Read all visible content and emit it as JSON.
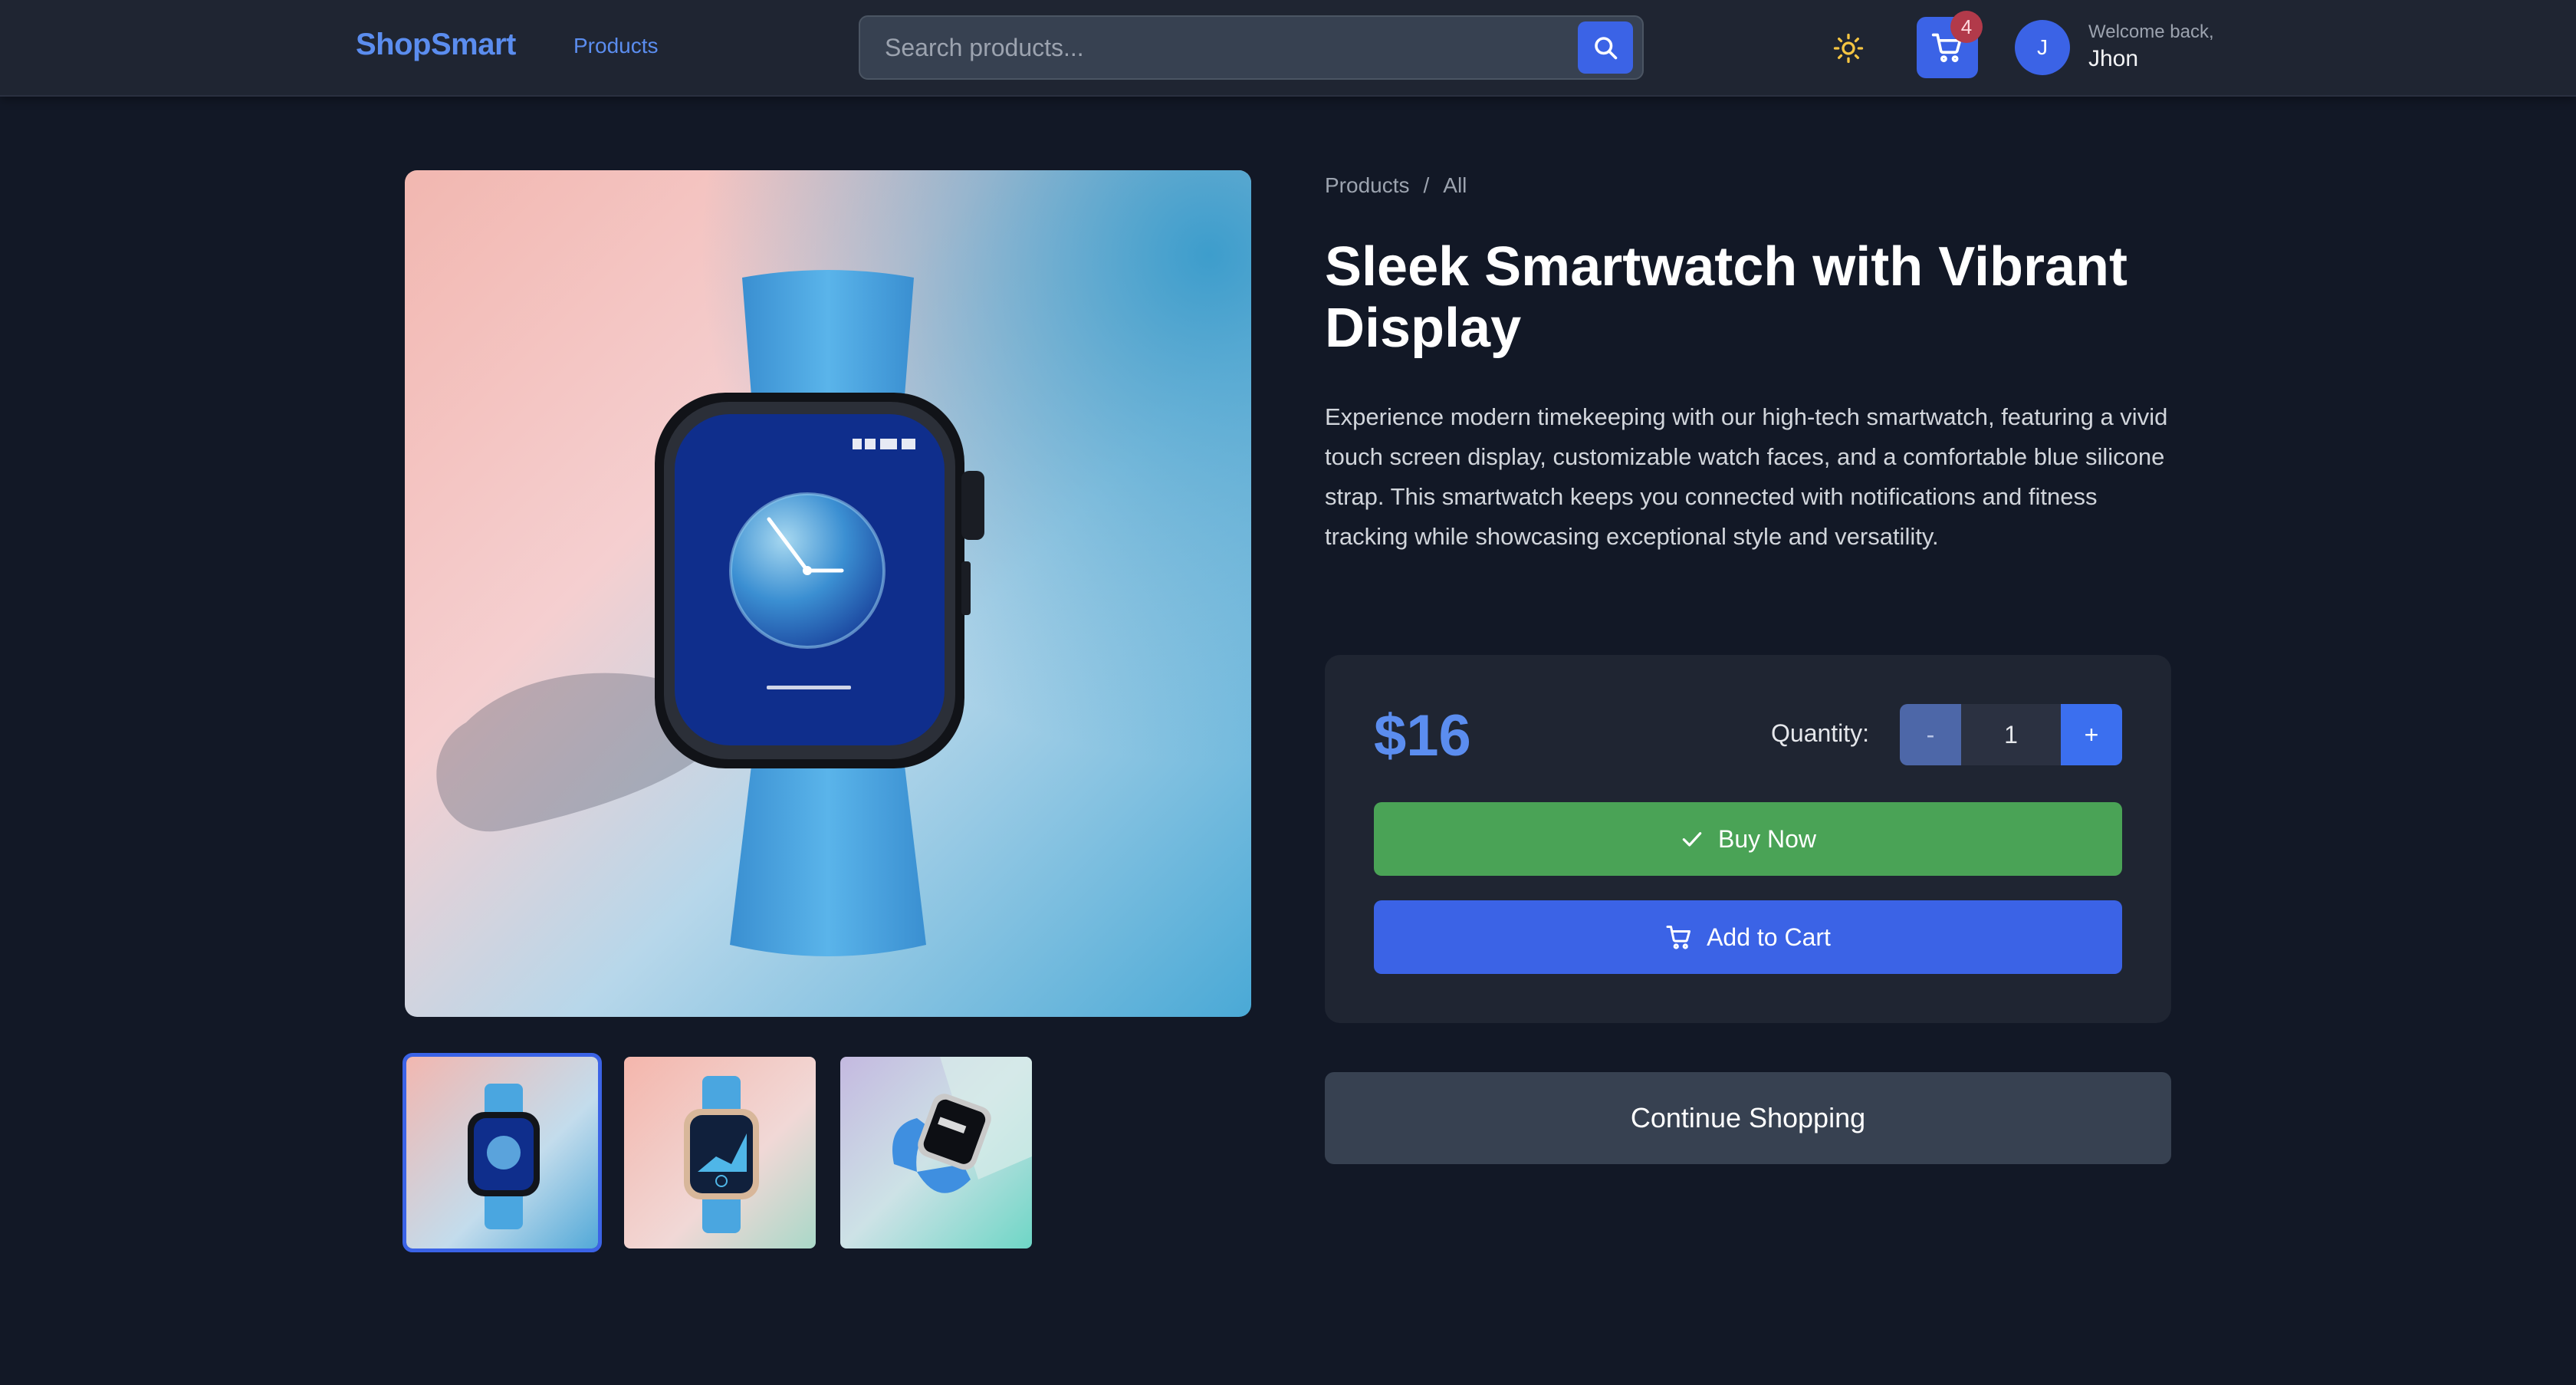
{
  "header": {
    "logo": "ShopSmart",
    "nav_products": "Products",
    "search_placeholder": "Search products...",
    "cart_count": "4",
    "avatar_initial": "J",
    "welcome_text": "Welcome back,",
    "username": "Jhon"
  },
  "breadcrumb": {
    "items": [
      "Products",
      "All"
    ],
    "separator": "/"
  },
  "product": {
    "title": "Sleek Smartwatch with Vibrant Display",
    "description": "Experience modern timekeeping with our high-tech smartwatch, featuring a vivid touch screen display, customizable watch faces, and a comfortable blue silicone strap. This smartwatch keeps you connected with notifications and fitness tracking while showcasing exceptional style and versatility.",
    "price": "$16",
    "quantity_label": "Quantity:",
    "quantity": "1",
    "minus_label": "-",
    "plus_label": "+",
    "buy_now_label": "Buy Now",
    "add_to_cart_label": "Add to Cart",
    "continue_label": "Continue Shopping"
  },
  "gallery": {
    "thumb_count": 3,
    "active_thumb": 0
  },
  "colors": {
    "background": "#121826",
    "accent": "#3b63e6",
    "buy_green": "#4aa356",
    "price_blue": "#5b8def"
  },
  "icons": {
    "search": "search-icon",
    "theme": "sun-icon",
    "cart": "cart-icon",
    "check": "check-icon"
  }
}
